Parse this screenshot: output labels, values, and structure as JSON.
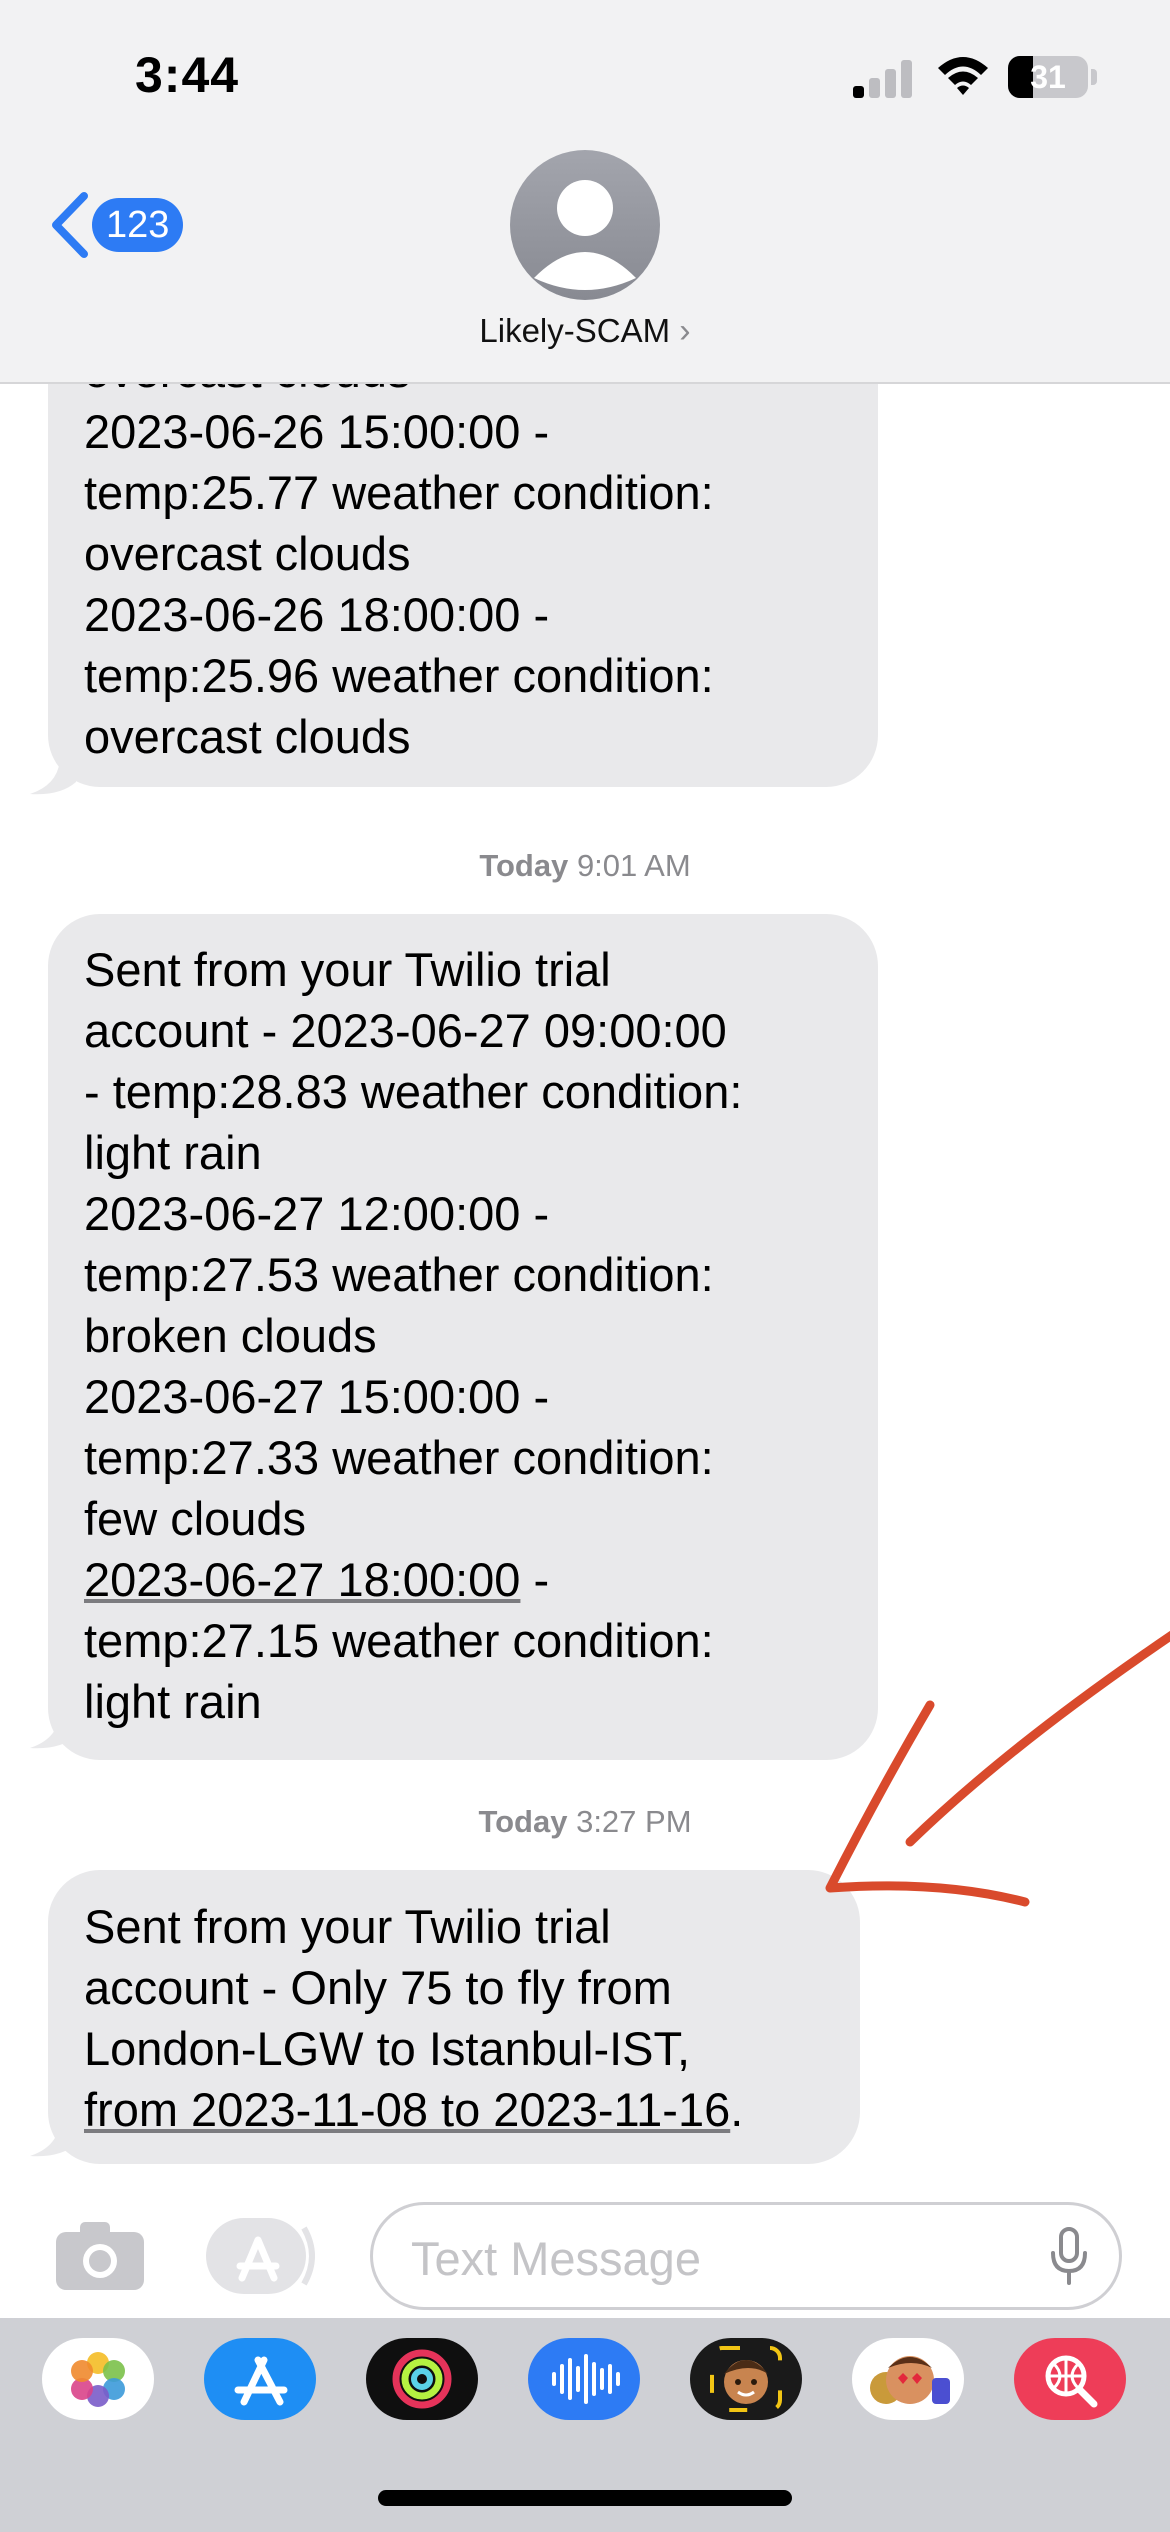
{
  "status_bar": {
    "time": "3:44",
    "battery_level": "31"
  },
  "nav": {
    "back_count": "123",
    "contact_name": "Likely-SCAM",
    "contact_chevron": "›"
  },
  "messages": {
    "first_bubble_lines": [
      "overcast clouds",
      "2023-06-26 15:00:00 -",
      "temp:25.77 weather condition:",
      "overcast clouds",
      "2023-06-26 18:00:00 -",
      "temp:25.96 weather condition:",
      "overcast clouds"
    ],
    "timestamp_2": {
      "day": "Today",
      "time": "9:01 AM"
    },
    "second_bubble_lines": [
      "Sent from your Twilio trial",
      "account - 2023-06-27 09:00:00",
      "- temp:28.83 weather condition:",
      "light rain",
      "2023-06-27 12:00:00 -",
      "temp:27.53 weather condition:",
      "broken clouds",
      "2023-06-27 15:00:00 -",
      "temp:27.33 weather condition:",
      "few clouds",
      "2023-06-27 18:00:00",
      " -",
      "temp:27.15 weather condition:",
      "light rain"
    ],
    "timestamp_3": {
      "day": "Today",
      "time": "3:27 PM"
    },
    "third_bubble_lines": [
      "Sent from your Twilio trial",
      "account - Only 75 to fly from",
      "London-LGW to Istanbul-IST,",
      "from 2023-11-08 to 2023-11-16",
      "."
    ]
  },
  "composer": {
    "placeholder": "Text Message"
  },
  "app_tray": {
    "apps": [
      "photos-icon",
      "app-store-icon",
      "fitness-icon",
      "voice-memos-icon",
      "memoji-icon",
      "animoji-stickers-icon",
      "search-web-icon"
    ]
  },
  "colors": {
    "accent_blue": "#2d7bf4",
    "bubble_gray": "#e9e9eb",
    "annotation_red": "#d94a2c"
  }
}
